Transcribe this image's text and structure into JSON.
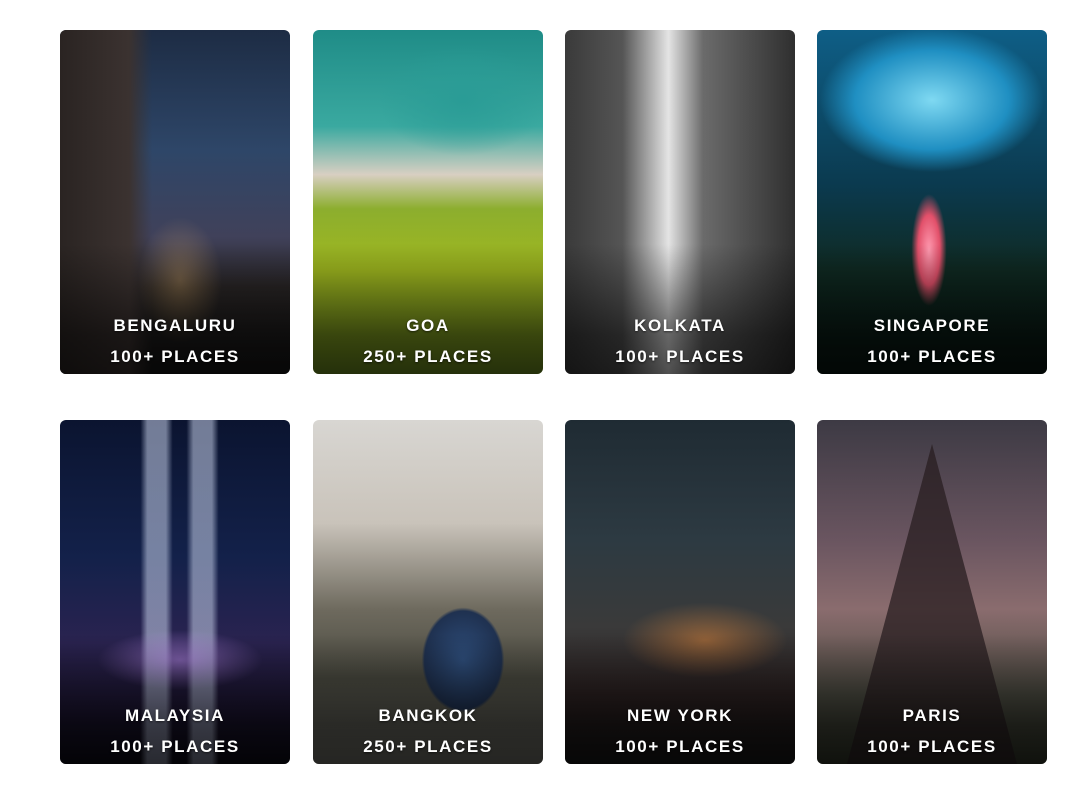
{
  "destinations": [
    {
      "name": "BENGALURU",
      "count": "100+ PLACES"
    },
    {
      "name": "GOA",
      "count": "250+ PLACES"
    },
    {
      "name": "KOLKATA",
      "count": "100+ PLACES"
    },
    {
      "name": "SINGAPORE",
      "count": "100+ PLACES"
    },
    {
      "name": "MALAYSIA",
      "count": "100+ PLACES"
    },
    {
      "name": "BANGKOK",
      "count": "250+ PLACES"
    },
    {
      "name": "NEW YORK",
      "count": "100+ PLACES"
    },
    {
      "name": "PARIS",
      "count": "100+ PLACES"
    }
  ]
}
